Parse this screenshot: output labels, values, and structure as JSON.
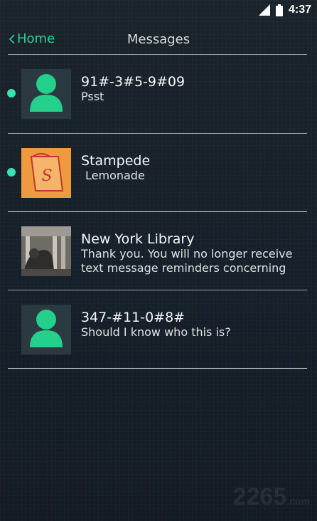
{
  "status_bar": {
    "time": "4:37",
    "icons": [
      "signal-icon",
      "battery-icon"
    ]
  },
  "nav": {
    "back_label": "Home",
    "title": "Messages"
  },
  "accent_color": "#2bd097",
  "unread_color": "#38e3b0",
  "conversations": [
    {
      "name": "91#-3#5-9#09",
      "preview": [
        "Psst"
      ],
      "unread": true,
      "avatar": "person-icon"
    },
    {
      "name": "Stampede",
      "preview": [
        "Lemonade"
      ],
      "unread": true,
      "avatar": "stampede-logo"
    },
    {
      "name": "New York Library",
      "preview": [
        "Thank you. You will no longer receive",
        "text message reminders concerning"
      ],
      "unread": false,
      "avatar": "library-photo"
    },
    {
      "name": "347-#11-0#8#",
      "preview": [
        "Should I know who this is?"
      ],
      "unread": false,
      "avatar": "person-icon"
    }
  ],
  "watermark": {
    "main": "2265",
    "sub": ".com"
  }
}
